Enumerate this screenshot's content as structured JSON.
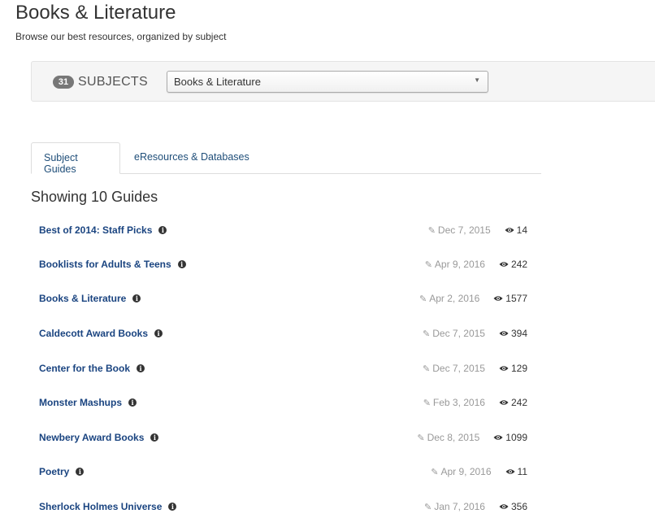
{
  "header": {
    "title": "Books & Literature",
    "subtitle": "Browse our best resources, organized by subject"
  },
  "subject_bar": {
    "count": "31",
    "label": "SUBJECTS",
    "selected": "Books & Literature"
  },
  "tabs": [
    {
      "label": "Subject Guides",
      "active": true
    },
    {
      "label": "eResources & Databases",
      "active": false
    }
  ],
  "showing": "Showing 10 Guides",
  "guides": [
    {
      "title": "Best of 2014: Staff Picks",
      "updated": "Dec 7, 2015",
      "views": "14"
    },
    {
      "title": "Booklists for Adults & Teens",
      "updated": "Apr 9, 2016",
      "views": "242"
    },
    {
      "title": "Books & Literature",
      "updated": "Apr 2, 2016",
      "views": "1577"
    },
    {
      "title": "Caldecott Award Books",
      "updated": "Dec 7, 2015",
      "views": "394"
    },
    {
      "title": "Center for the Book",
      "updated": "Dec 7, 2015",
      "views": "129"
    },
    {
      "title": "Monster Mashups",
      "updated": "Feb 3, 2016",
      "views": "242"
    },
    {
      "title": "Newbery Award Books",
      "updated": "Dec 8, 2015",
      "views": "1099"
    },
    {
      "title": "Poetry",
      "updated": "Apr 9, 2016",
      "views": "11"
    },
    {
      "title": "Sherlock Holmes Universe",
      "updated": "Jan 7, 2016",
      "views": "356"
    }
  ],
  "icons": {
    "info": "info-icon",
    "edit": "edit-icon",
    "views": "eye-icon",
    "caret": "caret-down-icon"
  },
  "colors": {
    "link": "#1a4480",
    "badge": "#777777",
    "muted": "#999999"
  }
}
